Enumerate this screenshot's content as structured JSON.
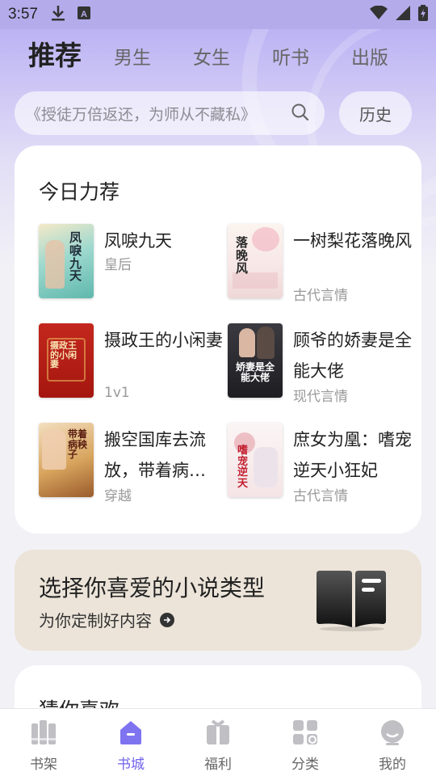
{
  "status_bar": {
    "time": "3:57"
  },
  "top_tabs": [
    {
      "label": "推荐",
      "active": true
    },
    {
      "label": "男生",
      "active": false
    },
    {
      "label": "女生",
      "active": false
    },
    {
      "label": "听书",
      "active": false
    },
    {
      "label": "出版",
      "active": false
    }
  ],
  "search": {
    "placeholder": "《授徒万倍返还，为师从不藏私》",
    "history_label": "历史"
  },
  "recommend": {
    "title": "今日力荐",
    "books": [
      {
        "title": "凤唳九天",
        "tag": "皇后",
        "cover_text": "凤唳九天"
      },
      {
        "title": "一树梨花落晚风",
        "tag": "古代言情",
        "cover_text": "落晚风"
      },
      {
        "title": "摄政王的小闲妻",
        "tag": "1v1",
        "cover_text": "摄政王的小闲妻"
      },
      {
        "title": "顾爷的娇妻是全能大佬",
        "tag": "现代言情",
        "cover_text": "娇妻是全能大佬"
      },
      {
        "title": "搬空国库去流放，带着病…",
        "tag": "穿越",
        "cover_text": "带着病秧子"
      },
      {
        "title": "庶女为凰：嗜宠逆天小狂妃",
        "tag": "古代言情",
        "cover_text": "嗜宠逆天"
      }
    ]
  },
  "genre_banner": {
    "title": "选择你喜爱的小说类型",
    "subtitle": "为你定制好内容"
  },
  "guess": {
    "title": "猜你喜欢"
  },
  "bottom_nav": [
    {
      "label": "书架",
      "icon": "bookshelf-icon",
      "active": false
    },
    {
      "label": "书城",
      "icon": "bookstore-icon",
      "active": true
    },
    {
      "label": "福利",
      "icon": "gift-icon",
      "active": false
    },
    {
      "label": "分类",
      "icon": "category-icon",
      "active": false
    },
    {
      "label": "我的",
      "icon": "profile-icon",
      "active": false
    }
  ],
  "colors": {
    "accent": "#6f63ec",
    "header_bg": "#b3a9f2",
    "banner_bg": "#ece4d9"
  }
}
